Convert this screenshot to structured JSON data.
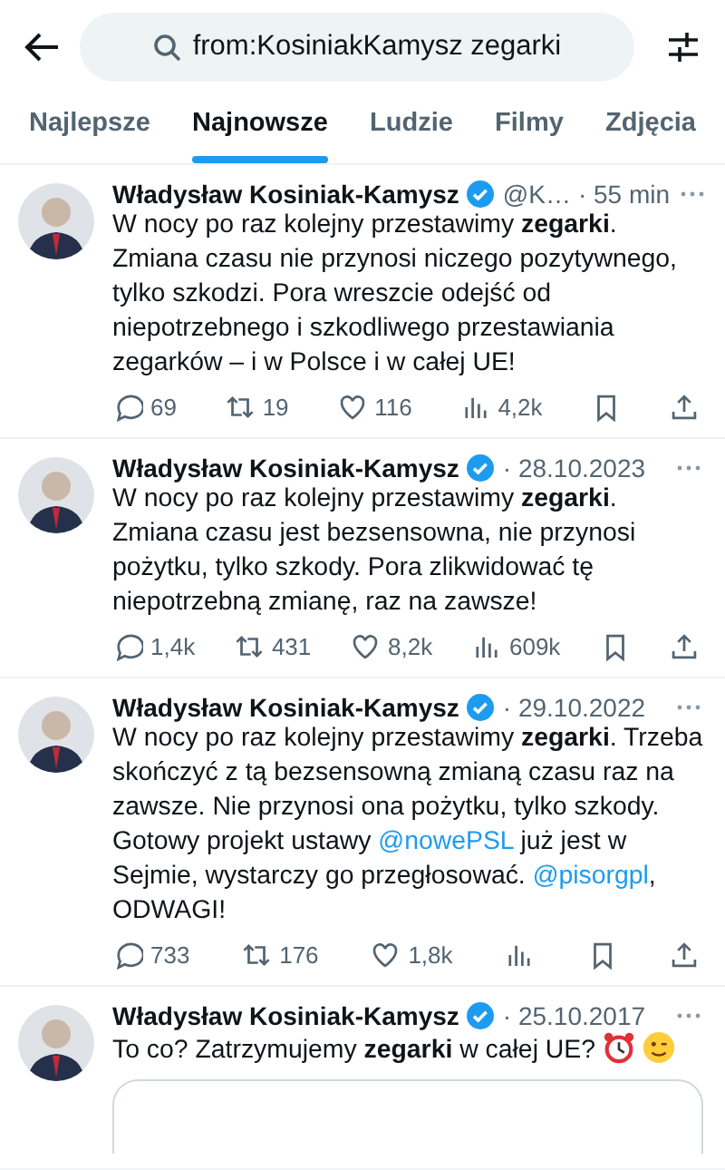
{
  "search": {
    "value": "from:KosiniakKamysz zegarki"
  },
  "tabs": [
    {
      "label": "Najlepsze",
      "selected": false
    },
    {
      "label": "Najnowsze",
      "selected": true
    },
    {
      "label": "Ludzie",
      "selected": false
    },
    {
      "label": "Filmy",
      "selected": false
    },
    {
      "label": "Zdjęcia",
      "selected": false
    }
  ],
  "tweets": [
    {
      "name": "Władysław Kosiniak-Kamysz",
      "handle": "@K…",
      "time": "· 55 min",
      "body": [
        {
          "kind": "text",
          "text": "W nocy po raz kolejny przestawimy **zegarki**. Zmiana czasu nie przynosi niczego pozytywnego, tylko szkodzi. Pora wreszcie odejść od niepotrzebnego i szkodliwego przestawiania zegarków – i w Polsce i w całej UE!"
        }
      ],
      "emoji": false,
      "quote": false,
      "stats": {
        "replies": "69",
        "reposts": "19",
        "likes": "116",
        "views": "4,2k"
      }
    },
    {
      "name": "Władysław Kosiniak-Kamysz",
      "time": "· 28.10.2023",
      "body": [
        {
          "kind": "text",
          "text": "W nocy po raz kolejny przestawimy **zegarki**. Zmiana czasu jest bezsensowna, nie przynosi pożytku, tylko szkody. Pora zlikwidować tę niepotrzebną zmianę, raz na zawsze!"
        }
      ],
      "emoji": false,
      "quote": false,
      "stats": {
        "replies": "1,4k",
        "reposts": "431",
        "likes": "8,2k",
        "views": "609k"
      }
    },
    {
      "name": "Władysław Kosiniak-Kamysz",
      "time": "· 29.10.2022",
      "body": [
        {
          "kind": "text",
          "text": "W nocy po raz kolejny przestawimy **zegarki**. Trzeba skończyć z tą bezsensowną zmianą czasu raz na zawsze. Nie przynosi ona pożytku, tylko szkody. Gotowy projekt ustawy "
        },
        {
          "kind": "mention",
          "text": "@nowePSL"
        },
        {
          "kind": "text",
          "text": " już jest w Sejmie, wystarczy go przegłosować. "
        },
        {
          "kind": "mention",
          "text": "@pisorgpl"
        },
        {
          "kind": "text",
          "text": ", ODWAGI!"
        }
      ],
      "emoji": false,
      "quote": false,
      "stats": {
        "replies": "733",
        "reposts": "176",
        "likes": "1,8k"
      }
    },
    {
      "name": "Władysław Kosiniak-Kamysz",
      "time": "· 25.10.2017",
      "body": [
        {
          "kind": "text",
          "text": "To co? Zatrzymujemy **zegarki** w całej UE?"
        }
      ],
      "emoji": true,
      "quote": true
    }
  ]
}
